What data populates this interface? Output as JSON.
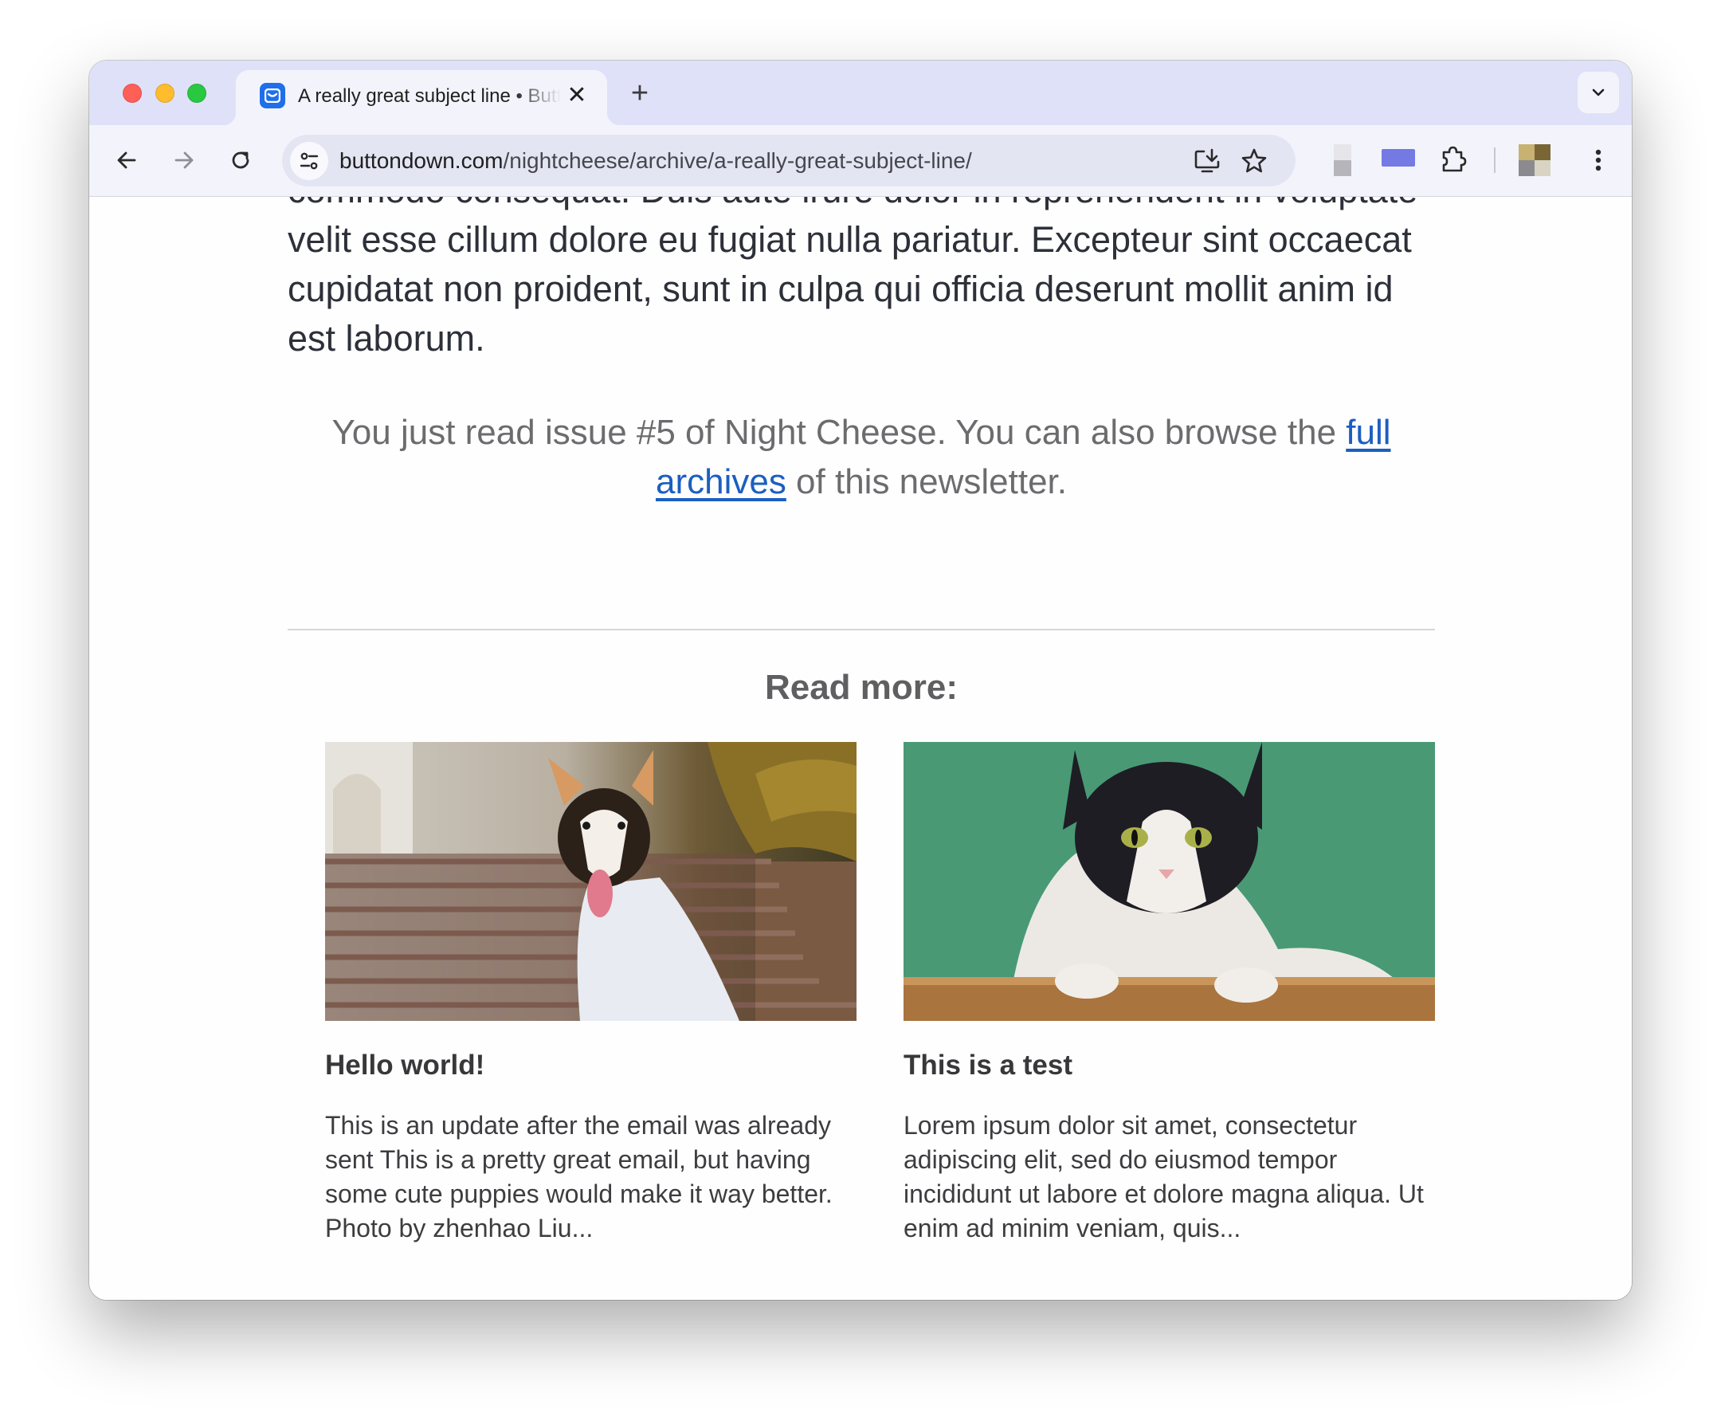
{
  "browser": {
    "tab": {
      "title": "A really great subject line • Buttondown",
      "close_symbol": "✕",
      "favicon": "buttondown-mailbox-icon"
    },
    "new_tab_symbol": "+",
    "url": {
      "host": "buttondown.com",
      "path": "/nightcheese/archive/a-really-great-subject-line/"
    },
    "icons": [
      "back-arrow-icon",
      "forward-arrow-icon",
      "reload-icon",
      "site-info-icon",
      "install-app-icon",
      "bookmark-star-icon",
      "extensions-puzzle-icon",
      "more-vert-icon",
      "tab-search-chevron-icon"
    ],
    "colors": {
      "tabstrip": "#dfe1f8",
      "toolbar": "#f3f4fb",
      "omnibox": "#e4e5f2",
      "link": "#1b5fc0"
    }
  },
  "page": {
    "article_text": "commodo consequat. Duis aute irure dolor in reprehenderit in voluptate velit esse cillum dolore eu fugiat nulla pariatur. Excepteur sint occaecat cupidatat non proident, sunt in culpa qui officia deserunt mollit anim id est laborum.",
    "footer": {
      "before_link": "You just read issue #5 of Night Cheese. You can also browse the ",
      "link_text": "full archives",
      "after_link": " of this newsletter."
    },
    "read_more_heading": "Read more:",
    "cards": [
      {
        "title": "Hello world!",
        "excerpt": "This is an update after the email was already sent This is a pretty great email, but having some cute puppies would make it way better. Photo by zhenhao Liu...",
        "image": "corgi-photo"
      },
      {
        "title": "This is a test",
        "excerpt": "Lorem ipsum dolor sit amet, consectetur adipiscing elit, sed do eiusmod tempor incididunt ut labore et dolore magna aliqua. Ut enim ad minim veniam, quis...",
        "image": "cat-photo"
      }
    ]
  }
}
